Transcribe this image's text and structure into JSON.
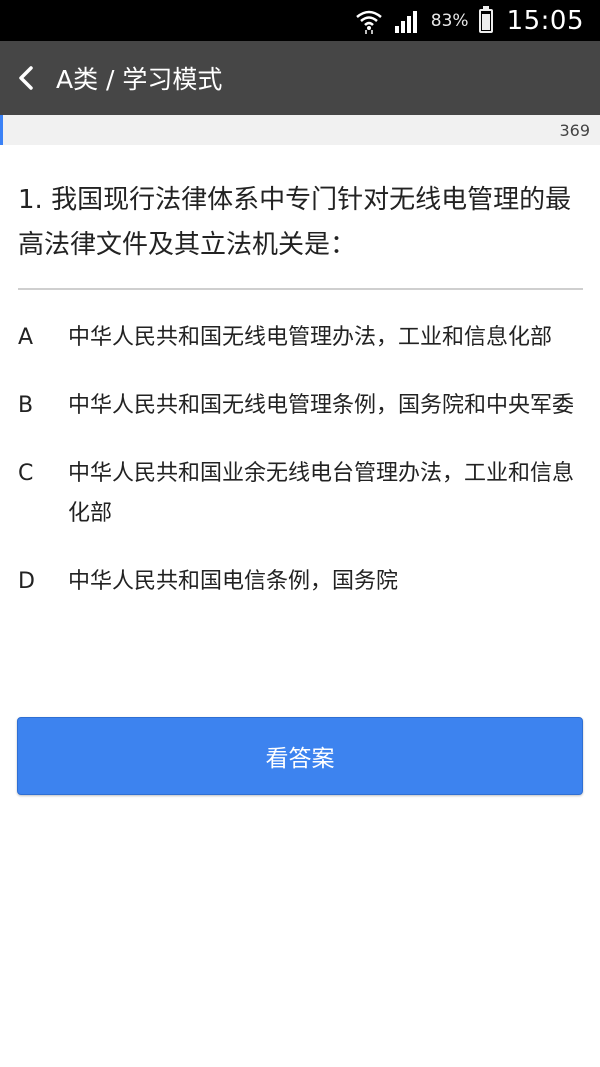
{
  "status_bar": {
    "battery_percent": "83%",
    "time": "15:05"
  },
  "app_bar": {
    "title": "A类 / 学习模式"
  },
  "progress": {
    "total": "369"
  },
  "question": {
    "text": "1. 我国现行法律体系中专门针对无线电管理的最高法律文件及其立法机关是："
  },
  "options": [
    {
      "letter": "A",
      "text": "中华人民共和国无线电管理办法，工业和信息化部"
    },
    {
      "letter": "B",
      "text": "中华人民共和国无线电管理条例，国务院和中央军委"
    },
    {
      "letter": "C",
      "text": "中华人民共和国业余无线电台管理办法，工业和信息化部"
    },
    {
      "letter": "D",
      "text": "中华人民共和国电信条例，国务院"
    }
  ],
  "actions": {
    "show_answer_label": "看答案"
  },
  "colors": {
    "accent": "#3d83ef",
    "app_bar": "#464646",
    "status_bar": "#000000"
  }
}
